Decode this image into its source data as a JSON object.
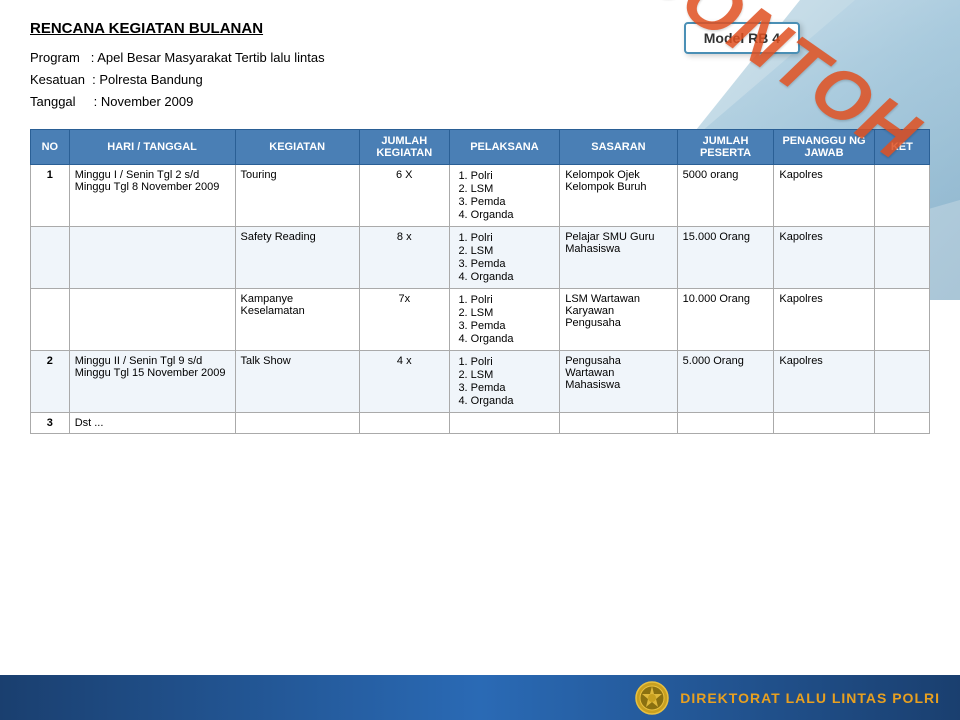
{
  "stamp": "CONTOH",
  "model_box": "Model RB 4",
  "header": {
    "title": "RENCANA KEGIATAN BULANAN",
    "program_label": "Program",
    "program_value": "Apel Besar Masyarakat Tertib lalu lintas",
    "kesatuan_label": "Kesatuan",
    "kesatuan_value": "Polresta Bandung",
    "tanggal_label": "Tanggal",
    "tanggal_value": "November 2009"
  },
  "table": {
    "columns": [
      "NO",
      "HARI / TANGGAL",
      "KEGIATAN",
      "JUMLAH KEGIATAN",
      "PELAKSANA",
      "SASARAN",
      "JUMLAH PESERTA",
      "PENANGGU NG JAWAB",
      "KET"
    ],
    "rows": [
      {
        "no": "1",
        "hari": "Minggu I / Senin Tgl 2 s/d Minggu Tgl 8 November 2009",
        "kegiatan": "Touring",
        "jumlah": "6 X",
        "pelaksana": [
          "Polri",
          "LSM",
          "Pemda",
          "Organda"
        ],
        "sasaran": "Kelompok Ojek Kelompok Buruh",
        "peserta": "5000 orang",
        "penanggung": "Kapolres",
        "ket": ""
      },
      {
        "no": "",
        "hari": "",
        "kegiatan": "Safety Reading",
        "jumlah": "8 x",
        "pelaksana": [
          "Polri",
          "LSM",
          "Pemda",
          "Organda"
        ],
        "sasaran": "Pelajar SMU Guru Mahasiswa",
        "peserta": "15.000 Orang",
        "penanggung": "Kapolres",
        "ket": ""
      },
      {
        "no": "",
        "hari": "",
        "kegiatan": "Kampanye Keselamatan",
        "jumlah": "7x",
        "pelaksana": [
          "Polri",
          "LSM",
          "Pemda",
          "Organda"
        ],
        "sasaran": "LSM Wartawan Karyawan Pengusaha",
        "peserta": "10.000 Orang",
        "penanggung": "Kapolres",
        "ket": ""
      },
      {
        "no": "2",
        "hari": "Minggu II / Senin Tgl 9 s/d Minggu Tgl 15 November 2009",
        "kegiatan": "Talk Show",
        "jumlah": "4 x",
        "pelaksana": [
          "Polri",
          "LSM",
          "Pemda",
          "Organda"
        ],
        "sasaran": "Pengusaha Wartawan Mahasiswa",
        "peserta": "5.000 Orang",
        "penanggung": "Kapolres",
        "ket": ""
      },
      {
        "no": "3",
        "hari": "Dst ...",
        "kegiatan": "",
        "jumlah": "",
        "pelaksana": [],
        "sasaran": "",
        "peserta": "",
        "penanggung": "",
        "ket": ""
      }
    ]
  },
  "footer": {
    "logo_text": "DIREKTORAT LALU LINTAS POLRI"
  }
}
